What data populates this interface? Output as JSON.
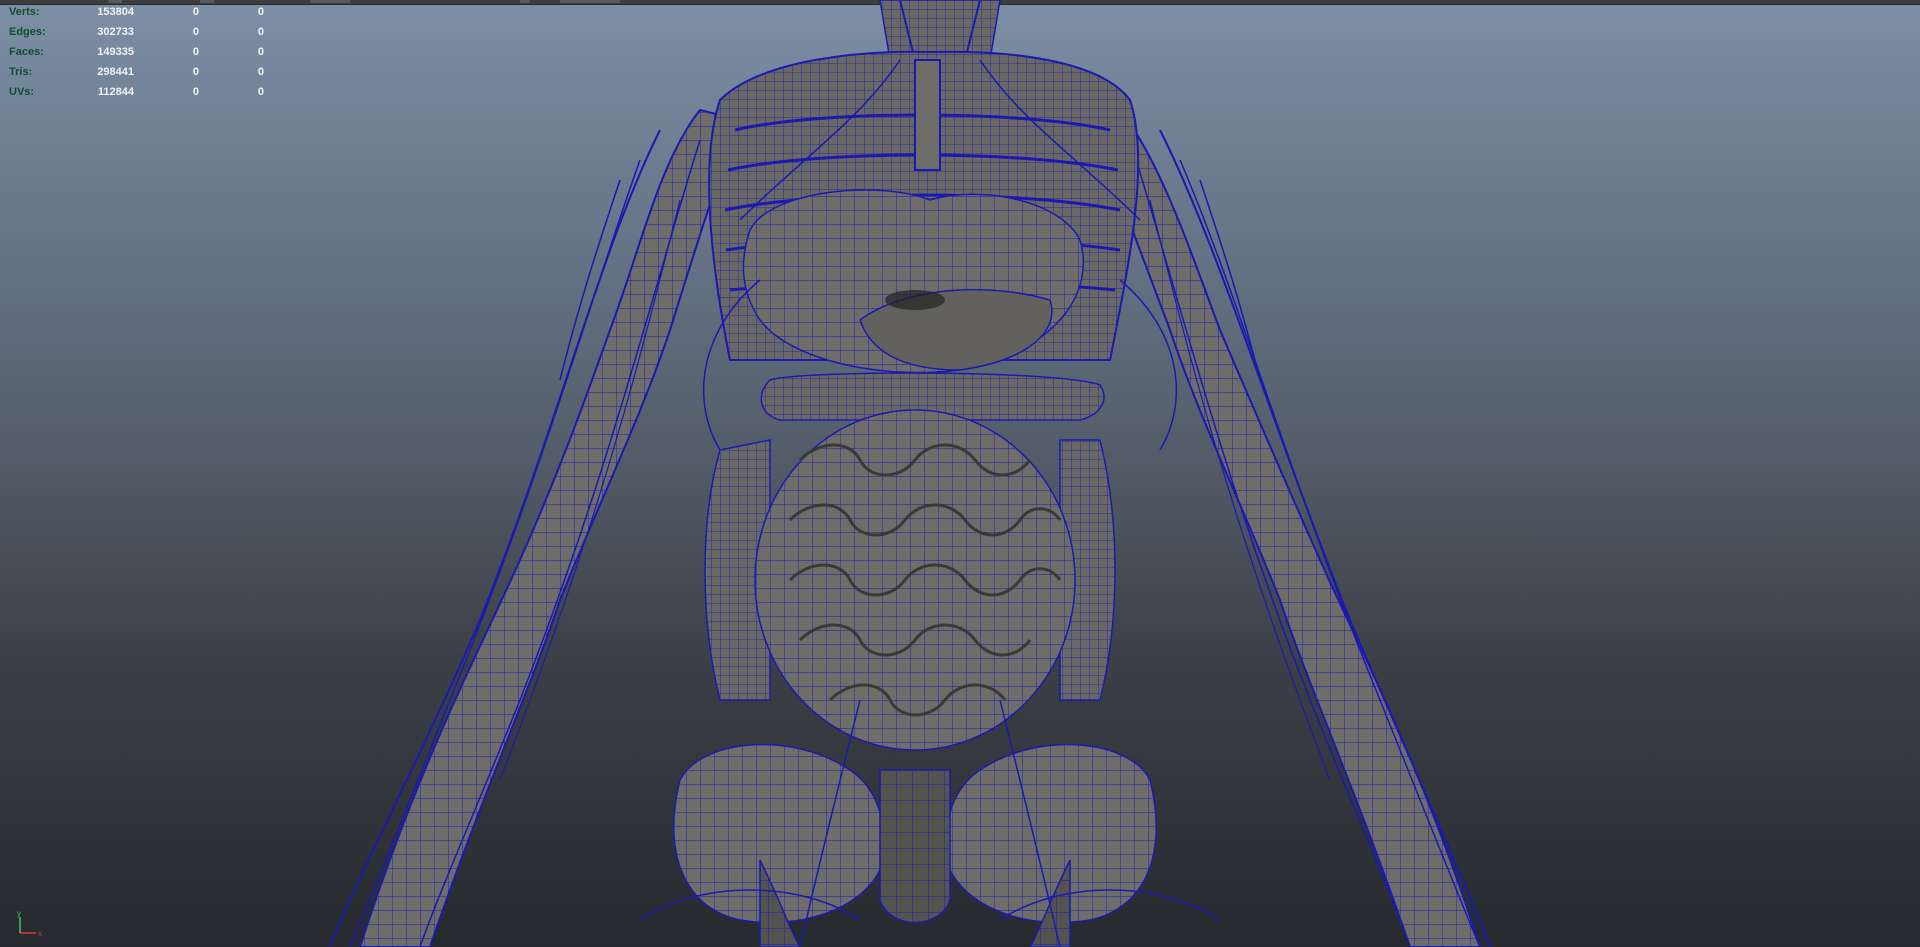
{
  "hud": {
    "rows": [
      {
        "label": "Verts:",
        "v1": "153804",
        "v2": "0",
        "v3": "0"
      },
      {
        "label": "Edges:",
        "v1": "302733",
        "v2": "0",
        "v3": "0"
      },
      {
        "label": "Faces:",
        "v1": "149335",
        "v2": "0",
        "v3": "0"
      },
      {
        "label": "Tris:",
        "v1": "298441",
        "v2": "0",
        "v3": "0"
      },
      {
        "label": "UVs:",
        "v1": "112844",
        "v2": "0",
        "v3": "0"
      }
    ]
  },
  "axis": {
    "y_label": "y",
    "x_label": "x",
    "y_color": "#39c46a",
    "x_color": "#d93a3a"
  },
  "colors": {
    "wire": "#1a1ab0",
    "mesh": "#6f6d6a",
    "hud_label": "#0d4f2e",
    "hud_value": "#f2f2f2"
  },
  "scene": {
    "subject": "anatomy-torso-wireframe"
  }
}
